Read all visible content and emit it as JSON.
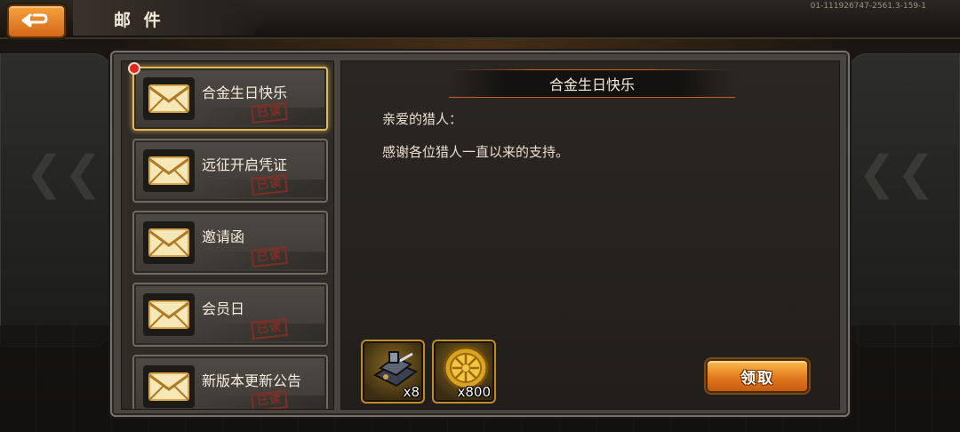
{
  "header": {
    "title": "邮 件",
    "build_id": "01-111926747-2561.3-159-1",
    "back_icon": "return-arrow-icon"
  },
  "mail_list": [
    {
      "subject": "合金生日快乐",
      "status": "已读",
      "selected": true,
      "unread_dot": true
    },
    {
      "subject": "远征开启凭证",
      "status": "已读",
      "selected": false
    },
    {
      "subject": "邀请函",
      "status": "已读",
      "selected": false
    },
    {
      "subject": "会员日",
      "status": "已读",
      "selected": false
    },
    {
      "subject": "新版本更新公告",
      "status": "已读",
      "selected": false
    }
  ],
  "detail": {
    "title": "合金生日快乐",
    "greeting": "亲爱的猎人：",
    "body": "感谢各位猎人一直以来的支持。",
    "attachments": [
      {
        "icon": "mech-part-icon",
        "qty": "x8"
      },
      {
        "icon": "gold-coin-icon",
        "qty": "x800"
      }
    ],
    "claim_label": "领取"
  },
  "colors": {
    "accent_orange": "#e0741c",
    "selected_border": "#e2b85a",
    "read_stamp": "#8e2c22",
    "unread_dot": "#e0261a"
  }
}
